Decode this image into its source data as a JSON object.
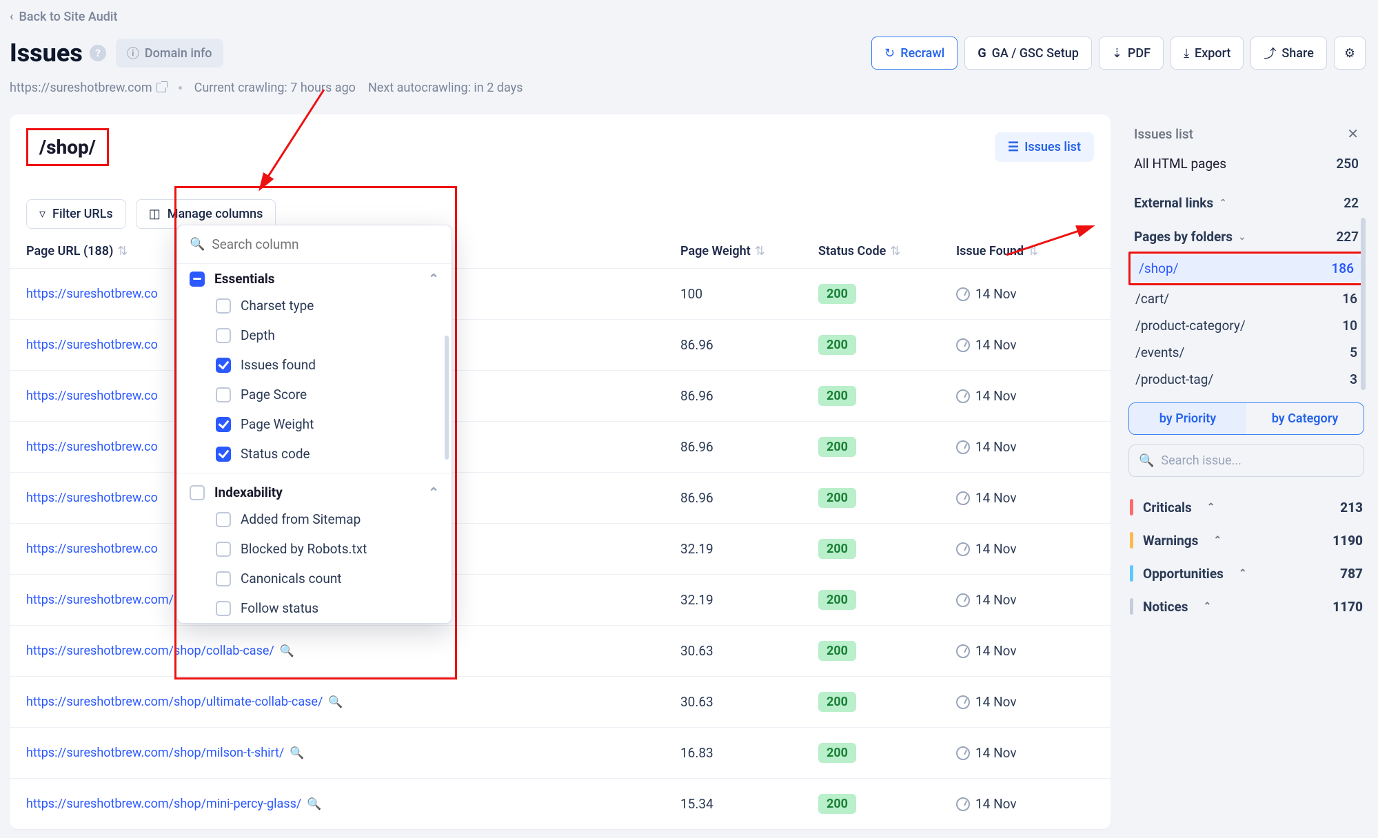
{
  "back_label": "Back to Site Audit",
  "page_title": "Issues",
  "domain_chip": "Domain info",
  "actions": {
    "recrawl": "Recrawl",
    "ga_gsc": "GA / GSC Setup",
    "pdf": "PDF",
    "export": "Export",
    "share": "Share"
  },
  "crawl": {
    "site": "https://sureshotbrew.com",
    "current": "Current crawling: 7 hours ago",
    "next": "Next autocrawling: in 2 days"
  },
  "folder_title": "/shop/",
  "issues_list_btn": "Issues list",
  "filter_urls": "Filter URLs",
  "manage_columns": "Manage columns",
  "columns_popover": {
    "search_placeholder": "Search column",
    "g1": "Essentials",
    "g1_items": [
      {
        "label": "Charset type",
        "on": false
      },
      {
        "label": "Depth",
        "on": false
      },
      {
        "label": "Issues found",
        "on": true
      },
      {
        "label": "Page Score",
        "on": false
      },
      {
        "label": "Page Weight",
        "on": true
      },
      {
        "label": "Status code",
        "on": true
      }
    ],
    "g2": "Indexability",
    "g2_items": [
      {
        "label": "Added from Sitemap",
        "on": false
      },
      {
        "label": "Blocked by Robots.txt",
        "on": false
      },
      {
        "label": "Canonicals count",
        "on": false
      },
      {
        "label": "Follow status",
        "on": false
      }
    ]
  },
  "table": {
    "hd_url": "Page URL (188)",
    "hd_weight": "Page Weight",
    "hd_status": "Status Code",
    "hd_issue": "Issue Found",
    "rows": [
      {
        "url": "https://sureshotbrew.co",
        "weight": "100",
        "status": "200",
        "date": "14 Nov",
        "truncated": true
      },
      {
        "url": "https://sureshotbrew.co",
        "weight": "86.96",
        "status": "200",
        "date": "14 Nov",
        "truncated": true
      },
      {
        "url": "https://sureshotbrew.co",
        "weight": "86.96",
        "status": "200",
        "date": "14 Nov",
        "truncated": true
      },
      {
        "url": "https://sureshotbrew.co",
        "weight": "86.96",
        "status": "200",
        "date": "14 Nov",
        "truncated": true
      },
      {
        "url": "https://sureshotbrew.co",
        "weight": "86.96",
        "status": "200",
        "date": "14 Nov",
        "truncated": true
      },
      {
        "url": "https://sureshotbrew.co",
        "weight": "32.19",
        "status": "200",
        "date": "14 Nov",
        "truncated": true
      },
      {
        "url": "https://sureshotbrew.com/shop/land-of-arches/",
        "weight": "32.19",
        "status": "200",
        "date": "14 Nov"
      },
      {
        "url": "https://sureshotbrew.com/shop/collab-case/",
        "weight": "30.63",
        "status": "200",
        "date": "14 Nov"
      },
      {
        "url": "https://sureshotbrew.com/shop/ultimate-collab-case/",
        "weight": "30.63",
        "status": "200",
        "date": "14 Nov"
      },
      {
        "url": "https://sureshotbrew.com/shop/milson-t-shirt/",
        "weight": "16.83",
        "status": "200",
        "date": "14 Nov"
      },
      {
        "url": "https://sureshotbrew.com/shop/mini-percy-glass/",
        "weight": "15.34",
        "status": "200",
        "date": "14 Nov"
      }
    ]
  },
  "sidebar": {
    "issues_list": "Issues list",
    "all_html": {
      "label": "All HTML pages",
      "count": "250"
    },
    "ext_links": {
      "label": "External links",
      "count": "22"
    },
    "pages_by_folders": {
      "label": "Pages by folders",
      "count": "227"
    },
    "folders": [
      {
        "label": "/shop/",
        "count": "186",
        "sel": true
      },
      {
        "label": "/cart/",
        "count": "16"
      },
      {
        "label": "/product-category/",
        "count": "10"
      },
      {
        "label": "/events/",
        "count": "5"
      },
      {
        "label": "/product-tag/",
        "count": "3"
      }
    ],
    "seg": {
      "priority": "by Priority",
      "category": "by Category"
    },
    "search_placeholder": "Search issue...",
    "sev": [
      {
        "label": "Criticals",
        "count": "213",
        "color": "#ff6b6b"
      },
      {
        "label": "Warnings",
        "count": "1190",
        "color": "#ffb84d"
      },
      {
        "label": "Opportunities",
        "count": "787",
        "color": "#5cc8ff"
      },
      {
        "label": "Notices",
        "count": "1170",
        "color": "#c6ccda"
      }
    ]
  }
}
